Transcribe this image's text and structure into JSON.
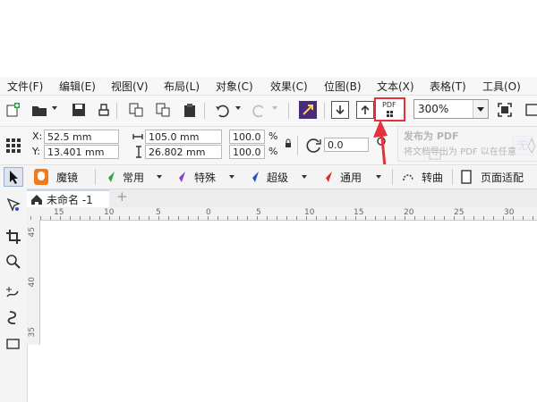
{
  "menubar": {
    "items": [
      "文件(F)",
      "编辑(E)",
      "视图(V)",
      "布局(L)",
      "对象(C)",
      "效果(C)",
      "位图(B)",
      "文本(X)",
      "表格(T)",
      "工具(O)"
    ]
  },
  "toolbar": {
    "pdf_label": "PDF",
    "zoom_value": "300%"
  },
  "propbar": {
    "x_label": "X:",
    "x_value": "52.5 mm",
    "y_label": "Y:",
    "y_value": "13.401 mm",
    "w_value": "105.0 mm",
    "h_value": "26.802 mm",
    "scale_x": "100.0",
    "scale_y": "100.0",
    "pct_x": "%",
    "pct_y": "%",
    "rotation_value": "0.0",
    "wrap_label": "无"
  },
  "tooltip": {
    "title": "发布为 PDF",
    "body": "将文档导出为 PDF 以在任意"
  },
  "toolsrow": {
    "magic": "魔镜",
    "common": "常用",
    "special": "特殊",
    "advanced": "超级",
    "general": "通用",
    "curve": "转曲",
    "fit_page": "页面适配"
  },
  "tabs": {
    "doc_name": "未命名 -1",
    "add": "+"
  },
  "ruler": {
    "h_labels": [
      "15",
      "10",
      "5",
      "0",
      "5",
      "10",
      "15",
      "20",
      "25",
      "30"
    ],
    "v_labels": [
      "45",
      "40",
      "35"
    ]
  },
  "colors": {
    "highlight": "#e8303a",
    "arrow": "#e8303a",
    "magic_orange": "#f07b1e",
    "green": "#2ea043",
    "purple": "#8a3ec8",
    "blue": "#2b50c8",
    "red": "#d8302b"
  }
}
